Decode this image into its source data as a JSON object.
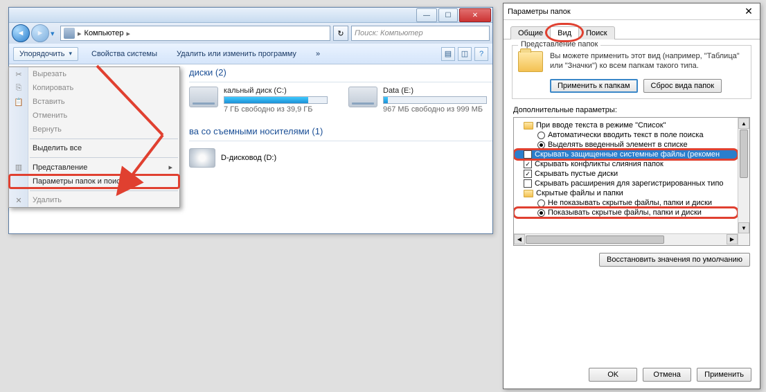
{
  "explorer": {
    "breadcrumb": {
      "root": "Компьютер",
      "arrow": "▸"
    },
    "search_placeholder": "Поиск: Компьютер",
    "toolbar": {
      "organize": "Упорядочить",
      "properties": "Свойства системы",
      "uninstall": "Удалить или изменить программу",
      "more": "»"
    },
    "menu": {
      "cut": "Вырезать",
      "copy": "Копировать",
      "paste": "Вставить",
      "undo": "Отменить",
      "redo": "Вернуть",
      "selectall": "Выделить все",
      "layout": "Представление",
      "folderopts": "Параметры папок и поиска",
      "delete": "Удалить"
    },
    "sect1": "диски (2)",
    "drives": [
      {
        "name": "кальный диск (C:)",
        "free": "7 ГБ свободно из 39,9 ГБ",
        "fill": 82
      },
      {
        "name": "Data (E:)",
        "free": "967 МБ свободно из 999 МБ",
        "fill": 4
      }
    ],
    "sect2": "ва со съемными носителями (1)",
    "dvd": "D-дисковод (D:)"
  },
  "dialog": {
    "title": "Параметры папок",
    "tabs": {
      "general": "Общие",
      "view": "Вид",
      "search": "Поиск"
    },
    "fieldset_legend": "Представление папок",
    "desc": "Вы можете применить этот вид (например, \"Таблица\" или \"Значки\") ко всем папкам такого типа.",
    "apply_folders": "Применить к папкам",
    "reset_folders": "Сброс вида папок",
    "adv_label": "Дополнительные параметры:",
    "tree": {
      "group1": "При вводе текста в режиме \"Список\"",
      "auto_search": "Автоматически вводить текст в поле поиска",
      "select_entered": "Выделять введенный элемент в списке",
      "hide_protected": "Скрывать защищенные системные файлы (рекомен",
      "hide_merge": "Скрывать конфликты слияния папок",
      "hide_empty": "Скрывать пустые диски",
      "hide_ext": "Скрывать расширения для зарегистрированных типо",
      "group2": "Скрытые файлы и папки",
      "hide_hidden": "Не показывать скрытые файлы, папки и диски",
      "show_hidden": "Показывать скрытые файлы, папки и диски"
    },
    "restore": "Восстановить значения по умолчанию",
    "ok": "OK",
    "cancel": "Отмена",
    "apply": "Применить"
  }
}
